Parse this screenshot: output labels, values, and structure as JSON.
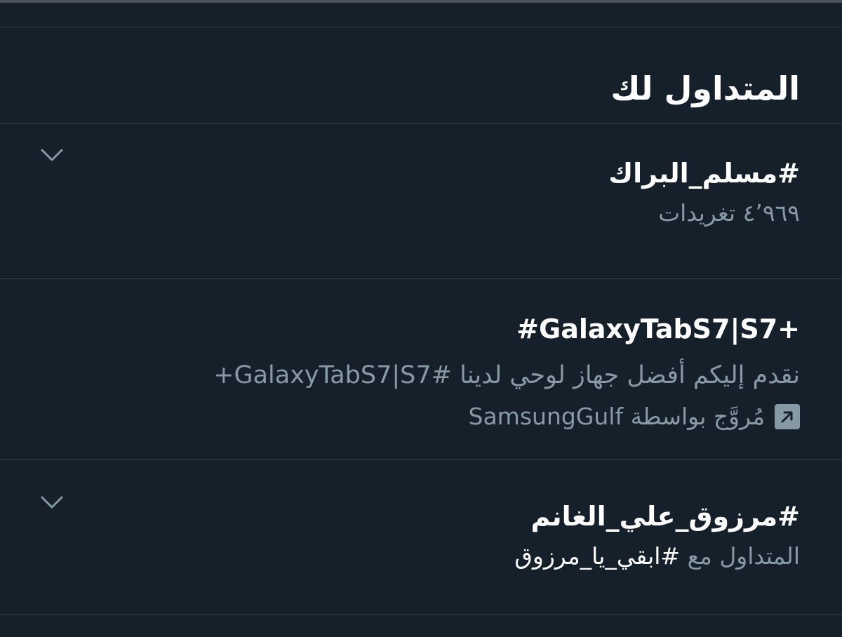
{
  "header": {
    "title": "المتداول لك"
  },
  "trends": [
    {
      "name": "#مسلم_البراك",
      "meta": "٤٬٩٦٩ تغريدات",
      "menu_icon": "chevron-down-icon"
    },
    {
      "name": "#GalaxyTabS7|S7+",
      "description": "نقدم إليكم أفضل جهاز لوحي لدينا #GalaxyTabS7|S7+",
      "promoted_label": "مُروَّج بواسطة SamsungGulf",
      "promoted_icon": "promoted-arrow-icon"
    },
    {
      "name": "#مرزوق_علي_الغانم",
      "meta_prefix": "المتداول مع",
      "meta_hashtag": "#ابقي_يا_مرزوق",
      "menu_icon": "chevron-down-icon"
    }
  ],
  "colors": {
    "background": "#15202b",
    "divider": "#38444d",
    "primary_text": "#ffffff",
    "secondary_text": "#8899a6"
  }
}
